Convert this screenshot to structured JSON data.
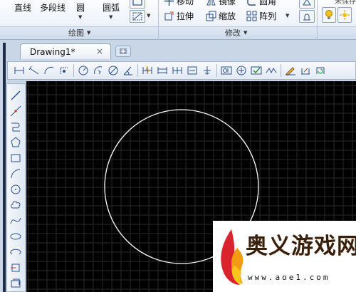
{
  "ribbon": {
    "draw_panel": {
      "line": "直线",
      "polyline": "多段线",
      "circle": "圆",
      "arc": "圆弧",
      "title": "绘图"
    },
    "modify_panel": {
      "move_partial": "移动",
      "mirror_partial": "镜像",
      "fillet_partial": "圆角",
      "stretch": "拉伸",
      "scale": "缩放",
      "array": "阵列",
      "title": "修改"
    },
    "layer_panel": {
      "layer_partial": "未保存的图层"
    }
  },
  "tabs": {
    "document": "Drawing1*",
    "close_glyph": "×"
  },
  "drawing": {
    "background": "#000000",
    "grid_color": "#2a2a2a",
    "circle_color": "#ffffff"
  },
  "watermark": {
    "name": "奥义游戏网",
    "url": "www.aoe1.com"
  }
}
